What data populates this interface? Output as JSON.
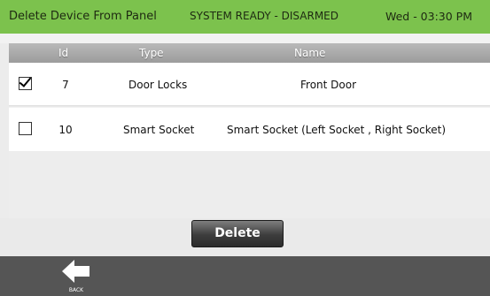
{
  "header": {
    "title": "Delete Device From Panel",
    "status": "SYSTEM READY - DISARMED",
    "time": "Wed - 03:30 PM",
    "bg_color": "#7cc24d"
  },
  "table": {
    "columns": [
      "Id",
      "Type",
      "Name"
    ],
    "rows": [
      {
        "checked": true,
        "id": "7",
        "type": "Door Locks",
        "name": "Front Door"
      },
      {
        "checked": false,
        "id": "10",
        "type": "Smart Socket",
        "name": "Smart Socket (Left Socket , Right Socket)"
      }
    ]
  },
  "actions": {
    "delete_label": "Delete"
  },
  "footer": {
    "back_label": "BACK",
    "back_icon": "arrow-left-icon"
  }
}
